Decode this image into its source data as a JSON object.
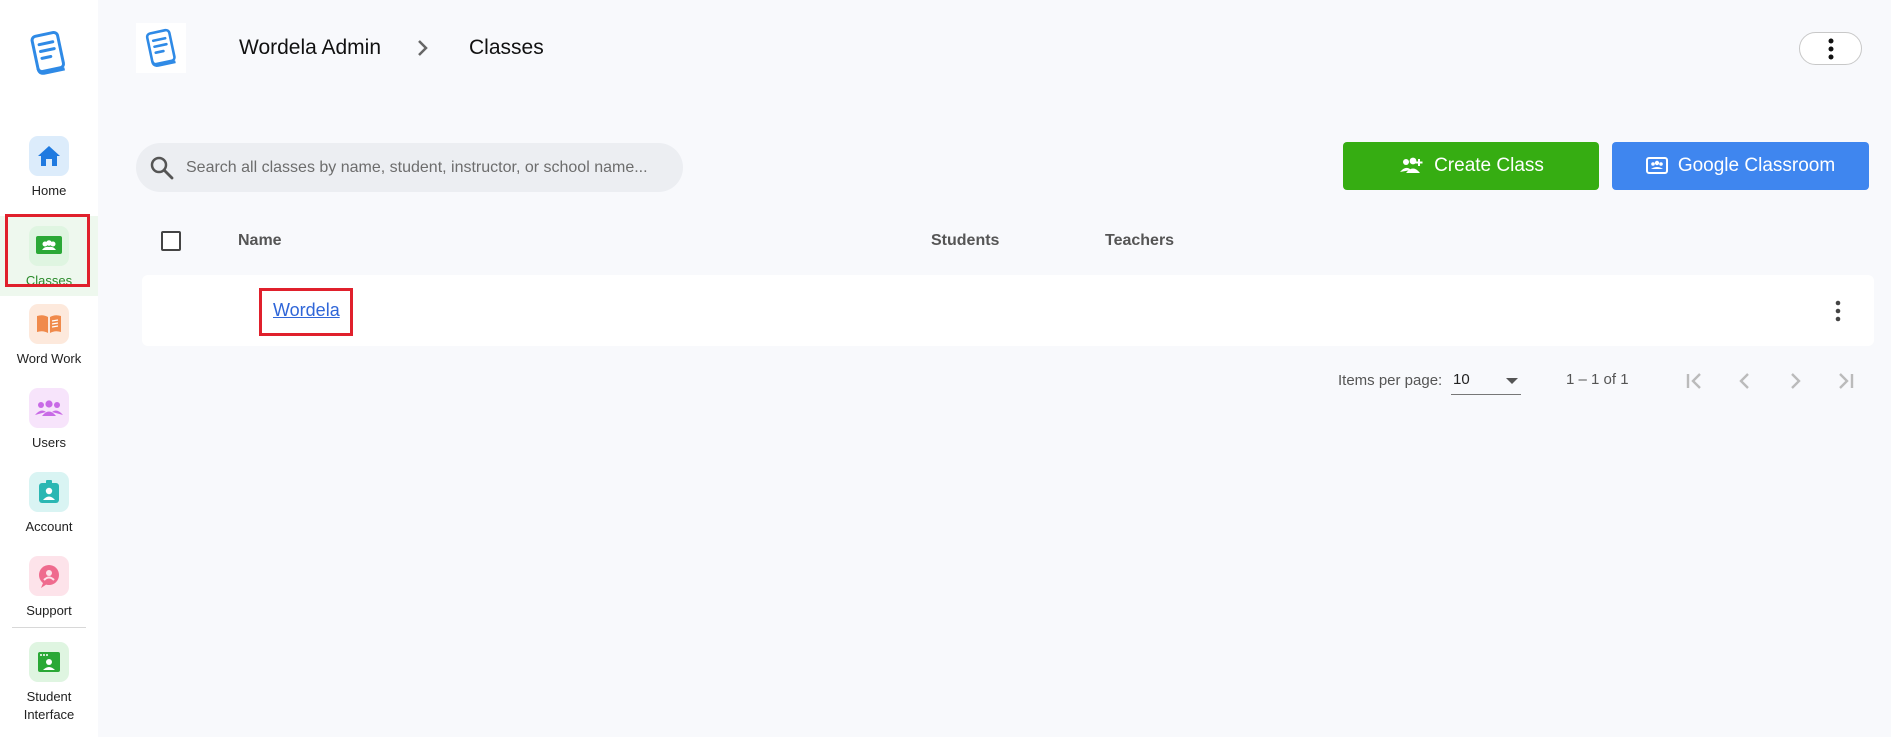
{
  "sidebar": {
    "items": [
      {
        "label": "Home",
        "icon": "home-icon",
        "color": "#1f7ae0",
        "bg": "#dcecfb"
      },
      {
        "label": "Classes",
        "icon": "classes-icon",
        "color": "#2aa836",
        "bg": "#dff5e1",
        "active": true
      },
      {
        "label": "Word Work",
        "icon": "book-icon",
        "color": "#f08a4b",
        "bg": "#fde9dc"
      },
      {
        "label": "Users",
        "icon": "users-icon",
        "color": "#c86ae6",
        "bg": "#f7e4fb"
      },
      {
        "label": "Account",
        "icon": "account-icon",
        "color": "#2bb7b3",
        "bg": "#d9f4f3"
      },
      {
        "label": "Support",
        "icon": "support-icon",
        "color": "#ef6b8e",
        "bg": "#fde3ea"
      },
      {
        "label": "Student Interface",
        "line1": "Student",
        "line2": "Interface",
        "icon": "student-interface-icon",
        "color": "#2aa836",
        "bg": "#dff5e1"
      }
    ]
  },
  "header": {
    "crumb_root": "Wordela Admin",
    "crumb_current": "Classes"
  },
  "search": {
    "placeholder": "Search all classes by name, student, instructor, or school name..."
  },
  "actions": {
    "create_label": "Create Class",
    "google_label": "Google Classroom"
  },
  "table": {
    "columns": {
      "name": "Name",
      "students": "Students",
      "teachers": "Teachers"
    },
    "rows": [
      {
        "name": "Wordela",
        "students": "",
        "teachers": ""
      }
    ]
  },
  "pagination": {
    "items_per_page_label": "Items per page:",
    "items_per_page_value": "10",
    "range": "1 – 1 of 1"
  },
  "colors": {
    "accent_green": "#36ad12",
    "accent_blue": "#3f86ef",
    "link": "#2f66d8",
    "highlight": "#e0202c"
  }
}
